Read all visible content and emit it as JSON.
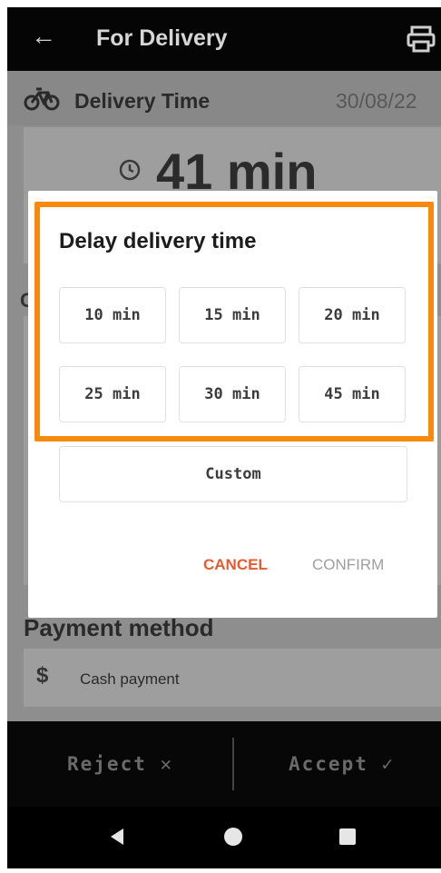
{
  "appbar": {
    "title": "For Delivery",
    "back_icon": "arrow-left-icon",
    "print_icon": "printer-icon"
  },
  "delivery": {
    "label": "Delivery Time",
    "date": "30/08/22",
    "icon": "bicycle-icon"
  },
  "estimate": {
    "value": "41 min",
    "icon": "clock-icon"
  },
  "ghost": {
    "letter": "C"
  },
  "payment": {
    "heading": "Payment method",
    "symbol": "$",
    "method": "Cash payment"
  },
  "actions": {
    "reject": "Reject ✕",
    "accept": "Accept ✓"
  },
  "dialog": {
    "title": "Delay delivery time",
    "options": [
      "10 min",
      "15 min",
      "20 min",
      "25 min",
      "30 min",
      "45 min"
    ],
    "custom": "Custom",
    "cancel": "CANCEL",
    "confirm": "CONFIRM"
  },
  "colors": {
    "accent": "#e65a2e",
    "highlight": "#f7890c",
    "overlay": "#8e8e8e"
  }
}
